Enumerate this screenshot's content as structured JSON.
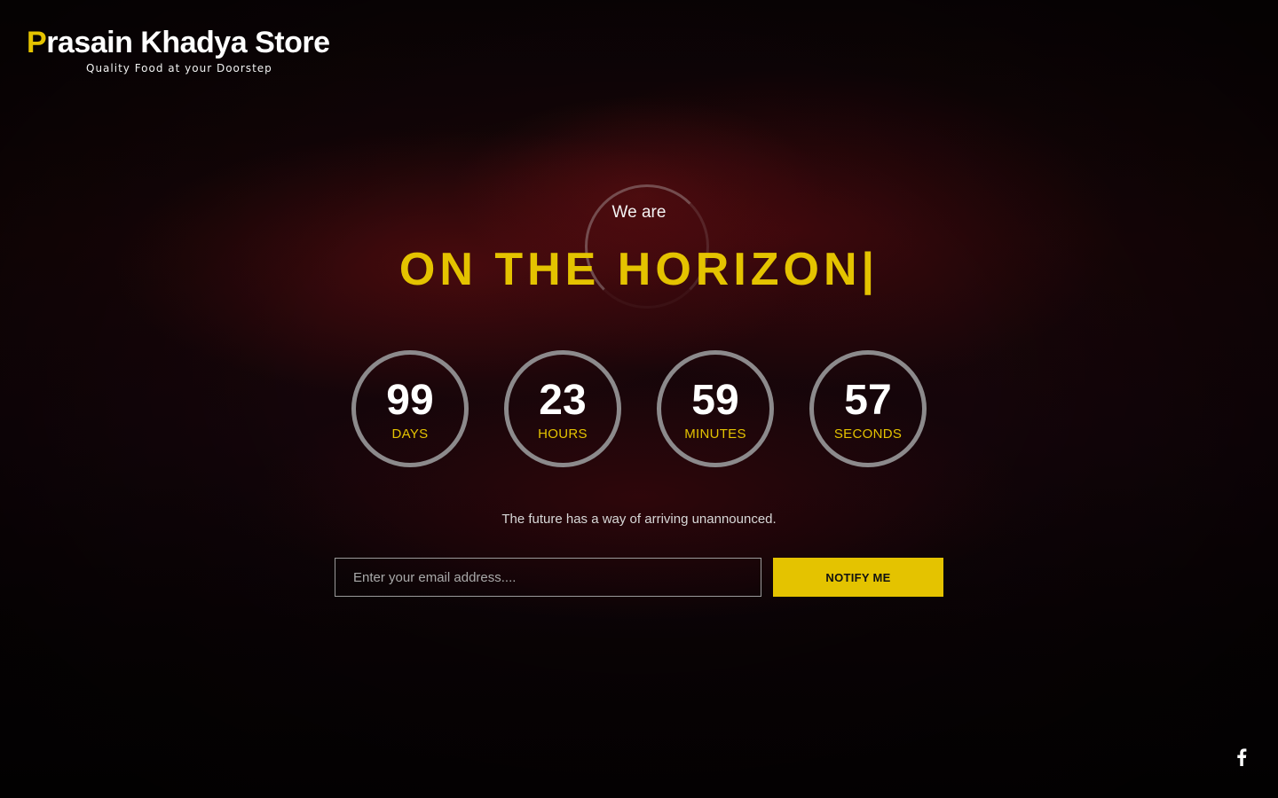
{
  "brand": {
    "initial": "P",
    "rest": "rasain Khadya Store",
    "tagline": "Quality Food at your Doorstep",
    "accent_color": "#e4c300"
  },
  "hero": {
    "intro": "We are",
    "headline": "ON THE HORIZON|"
  },
  "countdown": [
    {
      "value": "99",
      "label": "DAYS"
    },
    {
      "value": "23",
      "label": "HOURS"
    },
    {
      "value": "59",
      "label": "MINUTES"
    },
    {
      "value": "57",
      "label": "SECONDS"
    }
  ],
  "message": "The future has a way of arriving unannounced.",
  "form": {
    "email_placeholder": "Enter your email address....",
    "email_value": "",
    "button_label": "NOTIFY ME"
  },
  "social": {
    "icon": "facebook-icon"
  }
}
